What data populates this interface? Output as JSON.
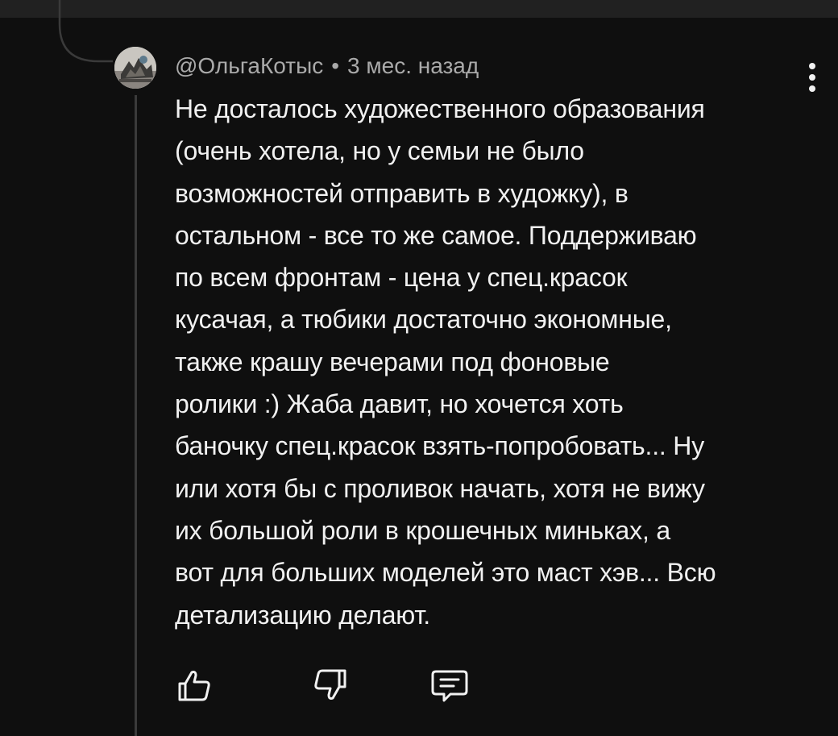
{
  "comment": {
    "author": "@ОльгаКотыс",
    "separator": "•",
    "timestamp": "3 мес. назад",
    "lines": [
      "Не досталось художественного образования",
      "(очень хотела, но у семьи не было",
      "возможностей отправить в художку), в",
      "остальном - все то же самое. Поддерживаю",
      "по всем фронтам - цена у спец.красок",
      "кусачая, а тюбики достаточно экономные,",
      "также крашу вечерами под фоновые",
      "ролики :) Жаба давит, но хочется хоть",
      "баночку спец.красок взять-попробовать... Ну",
      "или хотя бы с проливок начать, хотя не вижу",
      "их большой роли в крошечных миньках, а",
      "вот для больших моделей это маст хэв... Всю",
      "детализацию делают."
    ]
  },
  "actions": {
    "like_icon": "thumbs-up-icon",
    "dislike_icon": "thumbs-down-icon",
    "reply_icon": "comment-icon"
  },
  "colors": {
    "background": "#0f0f0f",
    "text": "#f1f1f1",
    "meta_text": "#aaaaaa",
    "thread_line": "#3a3a3a"
  }
}
